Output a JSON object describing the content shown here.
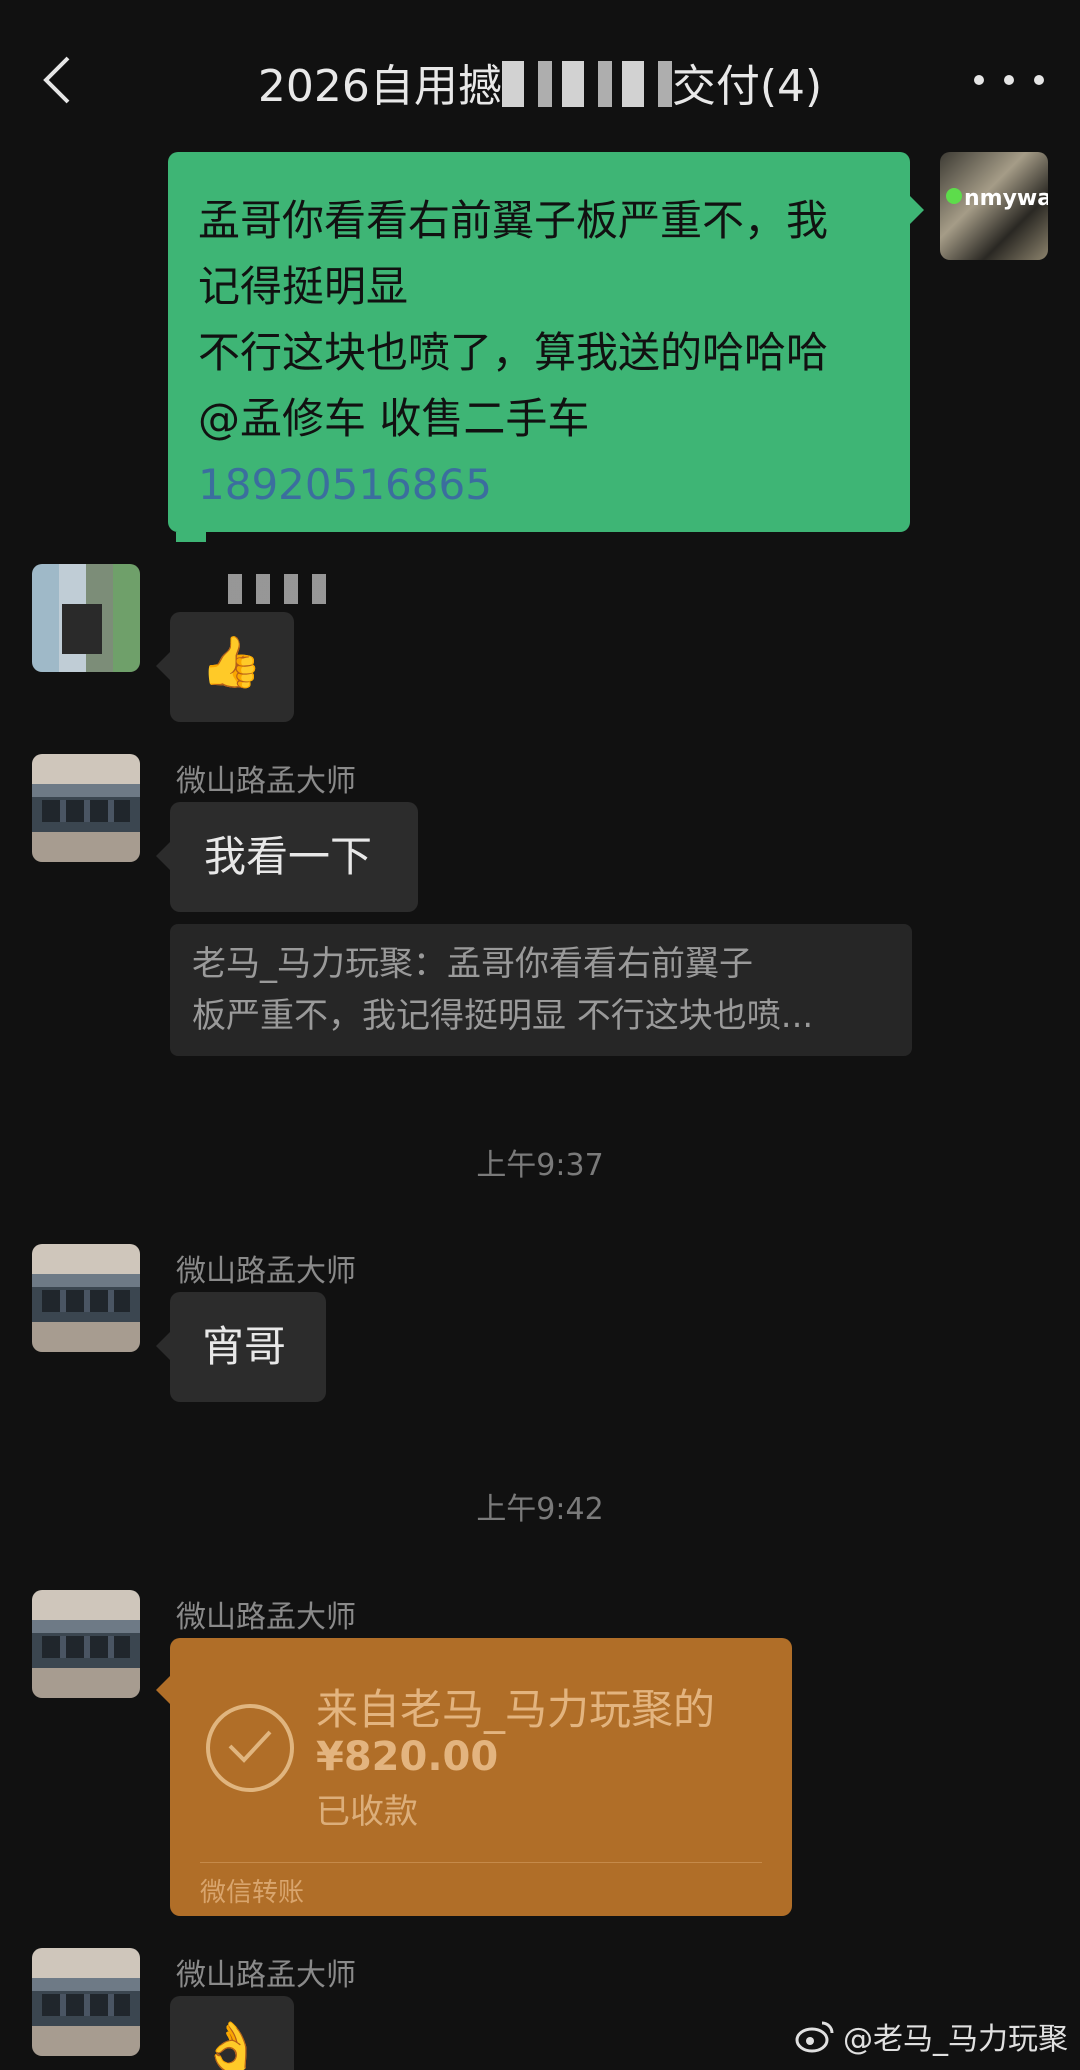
{
  "header": {
    "title_prefix": "2026自用撼",
    "title_suffix": "交付(4)"
  },
  "messages": {
    "m1_text": "孟哥你看看右前翼子板严重不，我\n记得挺明显\n不行这块也喷了，算我送的哈哈哈\n@孟修车 收售二手车\n",
    "m1_phone": "18920516865",
    "self_avatar_badge": "nmyway",
    "m2_emoji": "👍",
    "sender_name": "微山路孟大师",
    "m3_text": "我看一下",
    "quote_line1": "老马_马力玩聚：孟哥你看看右前翼子",
    "quote_line2": "板严重不，我记得挺明显 不行这块也喷...",
    "time1": "上午9:37",
    "m4_text": "宵哥",
    "time2": "上午9:42",
    "transfer": {
      "from": "来自老马_马力玩聚的",
      "amount": "¥820.00",
      "status": "已收款",
      "footer": "微信转账"
    },
    "m6_emoji": "👌"
  },
  "watermark": {
    "text": "@老马_马力玩聚"
  },
  "colors": {
    "background": "#111111",
    "self_bubble": "#3eb575",
    "other_bubble": "#2c2c2c",
    "transfer_card": "#b06e28"
  }
}
